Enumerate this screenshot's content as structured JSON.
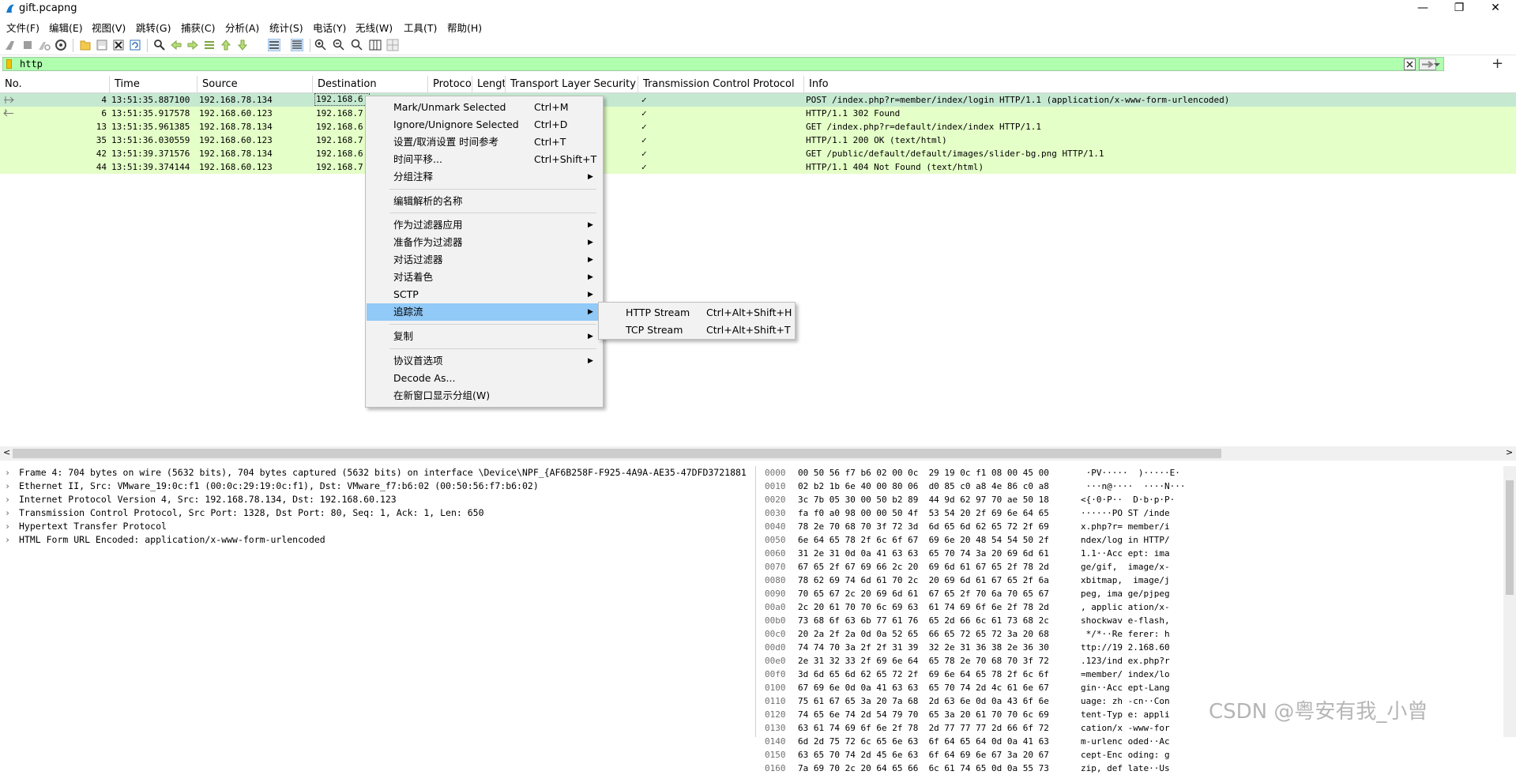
{
  "window": {
    "title": "gift.pcapng",
    "minimize": "—",
    "maximize": "❐",
    "close": "✕"
  },
  "menu": [
    "文件(F)",
    "编辑(E)",
    "视图(V)",
    "跳转(G)",
    "捕获(C)",
    "分析(A)",
    "统计(S)",
    "电话(Y)",
    "无线(W)",
    "工具(T)",
    "帮助(H)"
  ],
  "filter": {
    "value": "http",
    "bg_color": "#afffaf",
    "add_label": "+"
  },
  "columns": [
    "No.",
    "Time",
    "Source",
    "Destination",
    "Protoco",
    "Lengt",
    "Transport Layer Security",
    "Transmission Control Protocol",
    "Info"
  ],
  "packets": [
    {
      "no": "4",
      "time": "13:51:35.887100",
      "src": "192.168.78.134",
      "dst": "192.168.6",
      "tcp": "✓",
      "info": "POST /index.php?r=member/index/login HTTP/1.1  (application/x-www-form-urlencoded)"
    },
    {
      "no": "6",
      "time": "13:51:35.917578",
      "src": "192.168.60.123",
      "dst": "192.168.7",
      "tcp": "✓",
      "info": "HTTP/1.1 302 Found"
    },
    {
      "no": "13",
      "time": "13:51:35.961385",
      "src": "192.168.78.134",
      "dst": "192.168.6",
      "tcp": "✓",
      "info": "GET /index.php?r=default/index/index HTTP/1.1"
    },
    {
      "no": "35",
      "time": "13:51:36.030559",
      "src": "192.168.60.123",
      "dst": "192.168.7",
      "tcp": "✓",
      "info": "HTTP/1.1 200 OK  (text/html)"
    },
    {
      "no": "42",
      "time": "13:51:39.371576",
      "src": "192.168.78.134",
      "dst": "192.168.6",
      "tcp": "✓",
      "info": "GET /public/default/default/images/slider-bg.png HTTP/1.1"
    },
    {
      "no": "44",
      "time": "13:51:39.374144",
      "src": "192.168.60.123",
      "dst": "192.168.7",
      "tcp": "✓",
      "info": "HTTP/1.1 404 Not Found  (text/html)"
    }
  ],
  "row_colors": {
    "http": "#e4ffc7",
    "selected": "#c5e8d0"
  },
  "details": [
    "Frame 4: 704 bytes on wire (5632 bits), 704 bytes captured (5632 bits) on interface \\Device\\NPF_{AF6B258F-F925-4A9A-AE35-47DFD3721881",
    "Ethernet II, Src: VMware_19:0c:f1 (00:0c:29:19:0c:f1), Dst: VMware_f7:b6:02 (00:50:56:f7:b6:02)",
    "Internet Protocol Version 4, Src: 192.168.78.134, Dst: 192.168.60.123",
    "Transmission Control Protocol, Src Port: 1328, Dst Port: 80, Seq: 1, Ack: 1, Len: 650",
    "Hypertext Transfer Protocol",
    "HTML Form URL Encoded: application/x-www-form-urlencoded"
  ],
  "hex": [
    {
      "off": "0000",
      "bytes": "00 50 56 f7 b6 02 00 0c  29 19 0c f1 08 00 45 00",
      "ascii": " ·PV·····  )·····E·"
    },
    {
      "off": "0010",
      "bytes": "02 b2 1b 6e 40 00 80 06  d0 85 c0 a8 4e 86 c0 a8",
      "ascii": " ···n@····  ····N···"
    },
    {
      "off": "0020",
      "bytes": "3c 7b 05 30 00 50 b2 89  44 9d 62 97 70 ae 50 18",
      "ascii": "<{·0·P··  D·b·p·P·"
    },
    {
      "off": "0030",
      "bytes": "fa f0 a0 98 00 00 50 4f  53 54 20 2f 69 6e 64 65",
      "ascii": "······PO ST /inde"
    },
    {
      "off": "0040",
      "bytes": "78 2e 70 68 70 3f 72 3d  6d 65 6d 62 65 72 2f 69",
      "ascii": "x.php?r= member/i"
    },
    {
      "off": "0050",
      "bytes": "6e 64 65 78 2f 6c 6f 67  69 6e 20 48 54 54 50 2f",
      "ascii": "ndex/log in HTTP/"
    },
    {
      "off": "0060",
      "bytes": "31 2e 31 0d 0a 41 63 63  65 70 74 3a 20 69 6d 61",
      "ascii": "1.1··Acc ept: ima"
    },
    {
      "off": "0070",
      "bytes": "67 65 2f 67 69 66 2c 20  69 6d 61 67 65 2f 78 2d",
      "ascii": "ge/gif,  image/x-"
    },
    {
      "off": "0080",
      "bytes": "78 62 69 74 6d 61 70 2c  20 69 6d 61 67 65 2f 6a",
      "ascii": "xbitmap,  image/j"
    },
    {
      "off": "0090",
      "bytes": "70 65 67 2c 20 69 6d 61  67 65 2f 70 6a 70 65 67",
      "ascii": "peg, ima ge/pjpeg"
    },
    {
      "off": "00a0",
      "bytes": "2c 20 61 70 70 6c 69 63  61 74 69 6f 6e 2f 78 2d",
      "ascii": ", applic ation/x-"
    },
    {
      "off": "00b0",
      "bytes": "73 68 6f 63 6b 77 61 76  65 2d 66 6c 61 73 68 2c",
      "ascii": "shockwav e-flash,"
    },
    {
      "off": "00c0",
      "bytes": "20 2a 2f 2a 0d 0a 52 65  66 65 72 65 72 3a 20 68",
      "ascii": " */*··Re ferer: h"
    },
    {
      "off": "00d0",
      "bytes": "74 74 70 3a 2f 2f 31 39  32 2e 31 36 38 2e 36 30",
      "ascii": "ttp://19 2.168.60"
    },
    {
      "off": "00e0",
      "bytes": "2e 31 32 33 2f 69 6e 64  65 78 2e 70 68 70 3f 72",
      "ascii": ".123/ind ex.php?r"
    },
    {
      "off": "00f0",
      "bytes": "3d 6d 65 6d 62 65 72 2f  69 6e 64 65 78 2f 6c 6f",
      "ascii": "=member/ index/lo"
    },
    {
      "off": "0100",
      "bytes": "67 69 6e 0d 0a 41 63 63  65 70 74 2d 4c 61 6e 67",
      "ascii": "gin··Acc ept-Lang"
    },
    {
      "off": "0110",
      "bytes": "75 61 67 65 3a 20 7a 68  2d 63 6e 0d 0a 43 6f 6e",
      "ascii": "uage: zh -cn··Con"
    },
    {
      "off": "0120",
      "bytes": "74 65 6e 74 2d 54 79 70  65 3a 20 61 70 70 6c 69",
      "ascii": "tent-Typ e: appli"
    },
    {
      "off": "0130",
      "bytes": "63 61 74 69 6f 6e 2f 78  2d 77 77 77 2d 66 6f 72",
      "ascii": "cation/x -www-for"
    },
    {
      "off": "0140",
      "bytes": "6d 2d 75 72 6c 65 6e 63  6f 64 65 64 0d 0a 41 63",
      "ascii": "m-urlenc oded··Ac"
    },
    {
      "off": "0150",
      "bytes": "63 65 70 74 2d 45 6e 63  6f 64 69 6e 67 3a 20 67",
      "ascii": "cept-Enc oding: g"
    },
    {
      "off": "0160",
      "bytes": "7a 69 70 2c 20 64 65 66  6c 61 74 65 0d 0a 55 73",
      "ascii": "zip, def late··Us"
    }
  ],
  "context_menu": [
    {
      "label": "Mark/Unmark Selected",
      "shortcut": "Ctrl+M"
    },
    {
      "label": "Ignore/Unignore Selected",
      "shortcut": "Ctrl+D"
    },
    {
      "label": "设置/取消设置 时间参考",
      "shortcut": "Ctrl+T"
    },
    {
      "label": "时间平移...",
      "shortcut": "Ctrl+Shift+T"
    },
    {
      "label": "分组注释",
      "arrow": "▶"
    },
    {
      "label": "编辑解析的名称"
    },
    {
      "label": "作为过滤器应用",
      "arrow": "▶"
    },
    {
      "label": "准备作为过滤器",
      "arrow": "▶"
    },
    {
      "label": "对话过滤器",
      "arrow": "▶"
    },
    {
      "label": "对话着色",
      "arrow": "▶"
    },
    {
      "label": "SCTP",
      "arrow": "▶"
    },
    {
      "label": "追踪流",
      "arrow": "▶"
    },
    {
      "label": "复制",
      "arrow": "▶"
    },
    {
      "label": "协议首选项",
      "arrow": "▶"
    },
    {
      "label": "Decode As..."
    },
    {
      "label": "在新窗口显示分组(W)"
    }
  ],
  "submenu": [
    {
      "label": "HTTP Stream",
      "shortcut": "Ctrl+Alt+Shift+H"
    },
    {
      "label": "TCP Stream",
      "shortcut": "Ctrl+Alt+Shift+T"
    }
  ],
  "highlight_color": "#91c9f7",
  "watermark": "CSDN @粤安有我_小曾"
}
